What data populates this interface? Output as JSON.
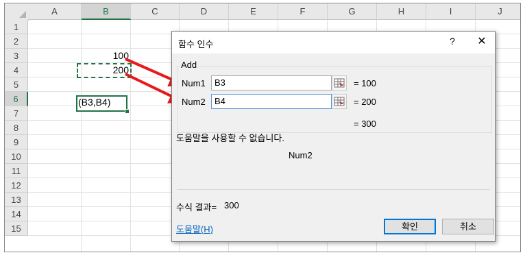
{
  "sheet": {
    "columns": [
      "A",
      "B",
      "C",
      "D",
      "E",
      "F",
      "G",
      "H",
      "I",
      "J"
    ],
    "rows": [
      "1",
      "2",
      "3",
      "4",
      "5",
      "6",
      "7",
      "8",
      "9",
      "10",
      "11",
      "12",
      "13",
      "14",
      "15"
    ],
    "active_column": "B",
    "active_row": "6",
    "cells": {
      "b3": "100",
      "b4": "200",
      "b6": "(B3,B4)"
    }
  },
  "dialog": {
    "title": "함수 인수",
    "help_label": "?",
    "close_label": "✕",
    "function_name": "Add",
    "args": [
      {
        "label": "Num1",
        "value": "B3",
        "result": "=  100"
      },
      {
        "label": "Num2",
        "value": "B4",
        "result": "=  200"
      }
    ],
    "total_result": "=  300",
    "help_unavailable": "도움말을 사용할 수 없습니다.",
    "current_arg": "Num2",
    "formula_result_label": "수식 결과=",
    "formula_result_value": "300",
    "help_link": "도움말(H)",
    "ok_label": "확인",
    "cancel_label": "취소"
  },
  "colors": {
    "accent": "#217346",
    "arrow": "#e8191b",
    "link": "#0563c1",
    "primary_border": "#0078d7"
  }
}
